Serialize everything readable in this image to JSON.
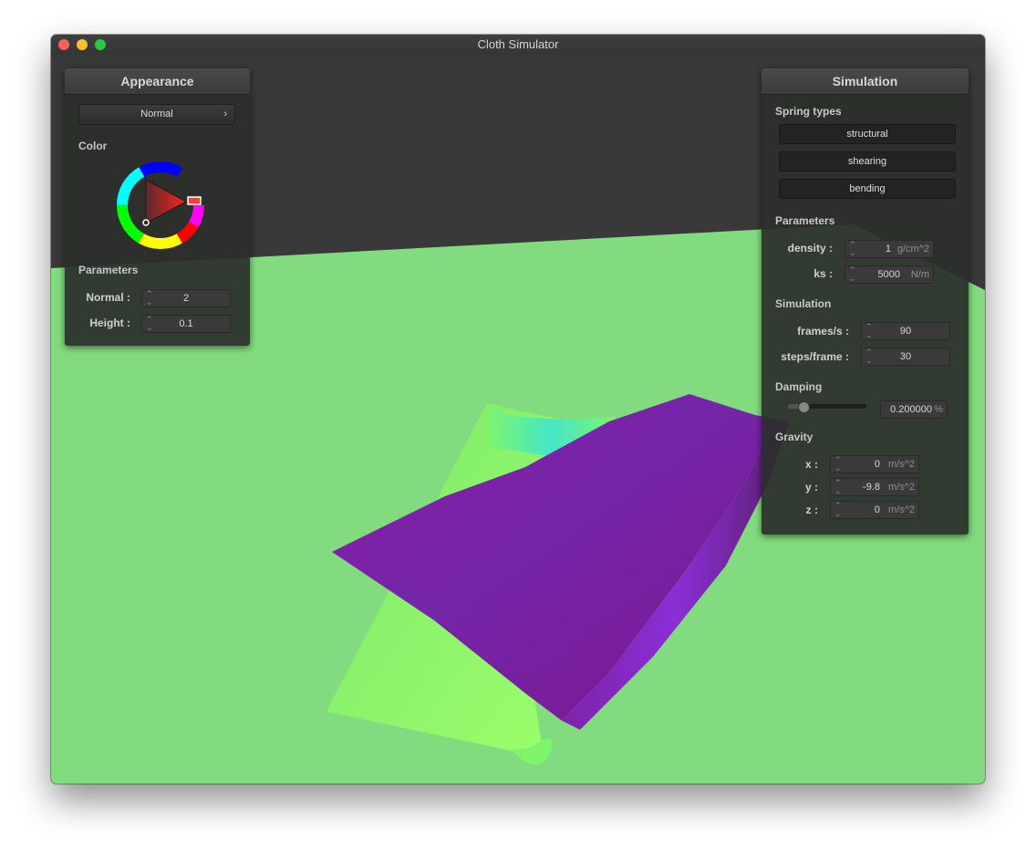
{
  "window": {
    "title": "Cloth Simulator"
  },
  "appearance": {
    "title": "Appearance",
    "shader_select": "Normal",
    "color_label": "Color",
    "params_label": "Parameters",
    "normal_label": "Normal :",
    "normal_value": "2",
    "height_label": "Height :",
    "height_value": "0.1"
  },
  "simulation_panel": {
    "title": "Simulation",
    "spring_types_label": "Spring types",
    "spring_buttons": [
      "structural",
      "shearing",
      "bending"
    ],
    "parameters_label": "Parameters",
    "density_label": "density :",
    "density_value": "1",
    "density_unit": "g/cm^2",
    "ks_label": "ks :",
    "ks_value": "5000",
    "ks_unit": "N/m",
    "simulation_label": "Simulation",
    "fps_label": "frames/s :",
    "fps_value": "90",
    "steps_label": "steps/frame :",
    "steps_value": "30",
    "damping_label": "Damping",
    "damping_value": "0.200000",
    "damping_unit": "%",
    "damping_fraction": 0.2,
    "gravity_label": "Gravity",
    "gx_label": "x :",
    "gx_value": "0",
    "gy_label": "y :",
    "gy_value": "-9.8",
    "gz_label": "z :",
    "gz_value": "0",
    "gravity_unit": "m/s^2"
  },
  "colors": {
    "floor": "#83db7f",
    "sky": "#393939",
    "cloth_top": "#7a1fa6",
    "cloth_under": "#7ef56c"
  },
  "icons": {
    "chevron": "chevron-right-icon",
    "spinner": "spinner-arrows-icon"
  }
}
